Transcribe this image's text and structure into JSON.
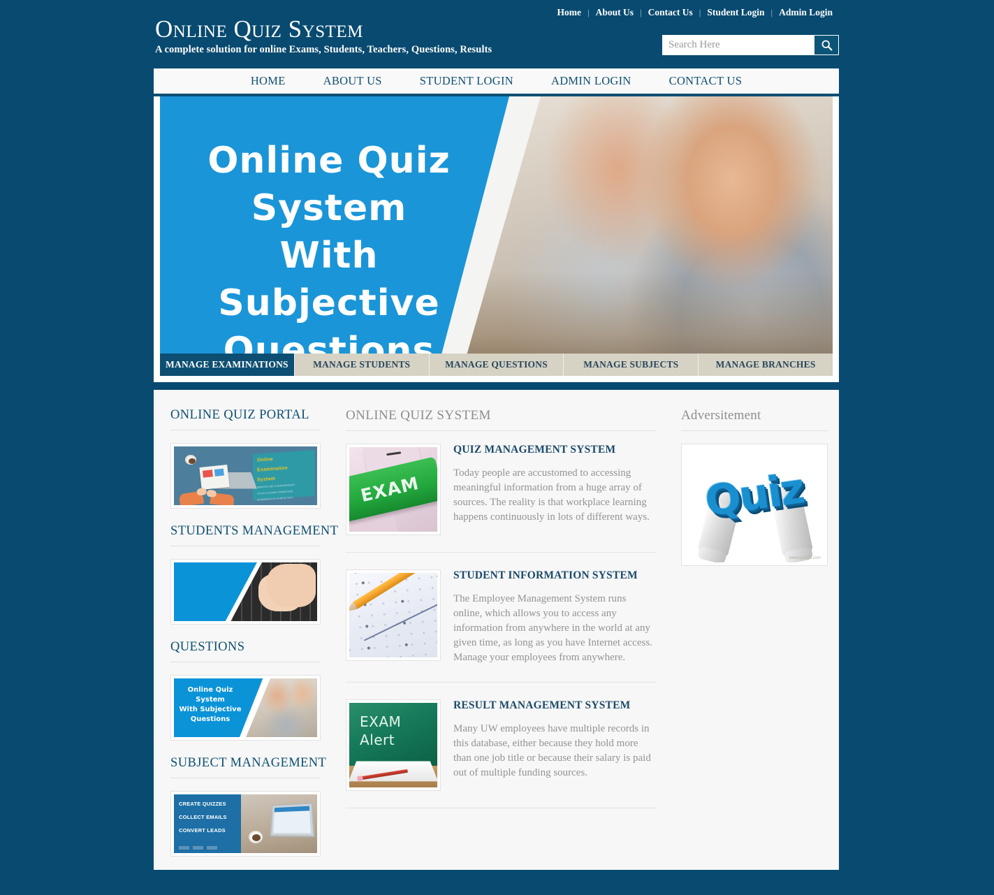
{
  "topbar": {
    "links": [
      {
        "label": "Home"
      },
      {
        "label": "About Us"
      },
      {
        "label": "Contact Us"
      },
      {
        "label": "Student Login"
      },
      {
        "label": "Admin Login"
      }
    ],
    "separator": "|"
  },
  "brand": {
    "title": "Online Quiz System",
    "tagline": "A complete solution for online Exams, Students, Teachers, Questions, Results"
  },
  "search": {
    "placeholder": "Search Here",
    "value": "",
    "icon": "search-icon"
  },
  "mainnav": {
    "items": [
      {
        "label": "HOME"
      },
      {
        "label": "ABOUT US"
      },
      {
        "label": "STUDENT LOGIN"
      },
      {
        "label": "ADMIN LOGIN"
      },
      {
        "label": "CONTACT US"
      }
    ]
  },
  "hero": {
    "line1": "Online Quiz",
    "line2": "System",
    "line3": "With Subjective",
    "line4": "Questions",
    "bg_color": "#1a95d8"
  },
  "tabs": [
    {
      "label": "MANAGE EXAMINATIONS",
      "active": true
    },
    {
      "label": "MANAGE STUDENTS",
      "active": false
    },
    {
      "label": "MANAGE QUESTIONS",
      "active": false
    },
    {
      "label": "MANAGE SUBJECTS",
      "active": false
    },
    {
      "label": "MANAGE BRANCHES",
      "active": false
    }
  ],
  "sidebar": {
    "sections": [
      {
        "heading": "ONLINE QUIZ PORTAL",
        "image": "online-examination-system-illustration"
      },
      {
        "heading": "STUDENTS MANAGEMENT",
        "image": "hands-typing-on-keyboard-photo"
      },
      {
        "heading": "QUESTIONS",
        "image": "online-quiz-system-banner-thumb"
      },
      {
        "heading": "SUBJECT MANAGEMENT",
        "image": "create-quizzes-laptop-photo"
      }
    ],
    "thumb3_text": {
      "l1": "Online Quiz",
      "l2": "System",
      "l3": "With Subjective",
      "l4": "Questions"
    },
    "thumb1_screen": {
      "title_l1": "Online",
      "title_l2": "Examination",
      "title_l3": "System",
      "sub_l1": "IMPROVE THE IT PERFORMANCE",
      "sub_l2": "TO GET A EXAMS STIMULATED",
      "sub_l3": "EXPERIENCE OF TO REAL TEST"
    },
    "thumb4_text": {
      "l1": "CREATE QUIZZES",
      "l2": "COLLECT EMAILS",
      "l3": "CONVERT LEADS"
    }
  },
  "main": {
    "heading": "ONLINE QUIZ SYSTEM",
    "articles": [
      {
        "title": "QUIZ MANAGEMENT SYSTEM",
        "text": "Today people are accustomed to accessing meaningful information from a huge array of sources. The reality is that workplace learning happens continuously in lots of different ways.",
        "image": "green-exam-keyboard-key",
        "image_label": "EXAM"
      },
      {
        "title": "STUDENT INFORMATION SYSTEM",
        "text": "The Employee Management System runs online, which allows you to access any information from anywhere in the world at any given time, as long as you have Internet access. Manage your employees from anywhere.",
        "image": "answer-sheet-with-pencil"
      },
      {
        "title": "RESULT MANAGEMENT SYSTEM",
        "text": "Many UW employees have multiple records in this database, either because they hold more than one job title or because their salary is paid out of multiple funding sources.",
        "image": "chalkboard-exam-alert",
        "image_label_l1": "EXAM",
        "image_label_l2": "Alert"
      }
    ]
  },
  "advert": {
    "heading": "Adversitement",
    "image": "quiz-word-carried-by-two-figures",
    "word": "Quiz",
    "credit": "www.qui101.com"
  },
  "colors": {
    "page_bg": "#084a70",
    "accent": "#0d4f72",
    "hero_blue": "#1a95d8",
    "tab_inactive": "#d6d2c4",
    "content_bg": "#f7f7f7",
    "body_text": "#939393"
  }
}
